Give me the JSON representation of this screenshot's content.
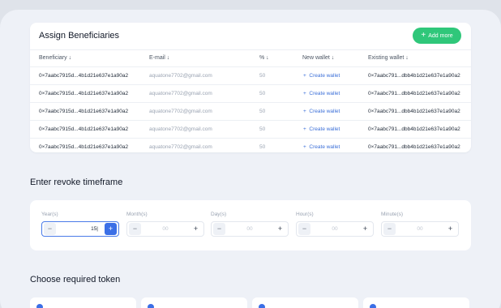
{
  "beneficiaries": {
    "title": "Assign Beneficiaries",
    "add_button_label": "Add more",
    "columns": [
      "Beneficiary ↓",
      "E-mail ↓",
      "% ↓",
      "New wallet ↓",
      "Existing wallet ↓"
    ],
    "rows": [
      {
        "beneficiary": "0×7aabc7915d...4b1d21e637e1a90a2",
        "email": "aquatone7702@gmail.com",
        "percent": "50",
        "new_wallet": "Create wallet",
        "existing_wallet": "0×7aabc791...dbb4b1d21e637e1a90a2"
      },
      {
        "beneficiary": "0×7aabc7915d...4b1d21e637e1a90a2",
        "email": "aquatone7702@gmail.com",
        "percent": "50",
        "new_wallet": "Create wallet",
        "existing_wallet": "0×7aabc791...dbb4b1d21e637e1a90a2"
      },
      {
        "beneficiary": "0×7aabc7915d...4b1d21e637e1a90a2",
        "email": "aquatone7702@gmail.com",
        "percent": "50",
        "new_wallet": "Create wallet",
        "existing_wallet": "0×7aabc791...dbb4b1d21e637e1a90a2"
      },
      {
        "beneficiary": "0×7aabc7915d...4b1d21e637e1a90a2",
        "email": "aquatone7702@gmail.com",
        "percent": "50",
        "new_wallet": "Create wallet",
        "existing_wallet": "0×7aabc791...dbb4b1d21e637e1a90a2"
      },
      {
        "beneficiary": "0×7aabc7915d...4b1d21e637e1a90a2",
        "email": "aquatone7702@gmail.com",
        "percent": "50",
        "new_wallet": "Create wallet",
        "existing_wallet": "0×7aabc791...dbb4b1d21e637e1a90a2"
      }
    ]
  },
  "timeframe": {
    "title": "Enter revoke timeframe",
    "fields": [
      {
        "label": "Year(s)",
        "value": "15|",
        "placeholder": "00",
        "active": true
      },
      {
        "label": "Month(s)",
        "value": "",
        "placeholder": "00",
        "active": false
      },
      {
        "label": "Day(s)",
        "value": "",
        "placeholder": "00",
        "active": false
      },
      {
        "label": "Hour(s)",
        "value": "",
        "placeholder": "00",
        "active": false
      },
      {
        "label": "Minute(s)",
        "value": "",
        "placeholder": "00",
        "active": false
      }
    ]
  },
  "tokens": {
    "title": "Choose required token"
  },
  "colors": {
    "accent_green": "#2fc77a",
    "accent_blue": "#3b6fe6",
    "link_blue": "#3b6fd8"
  }
}
